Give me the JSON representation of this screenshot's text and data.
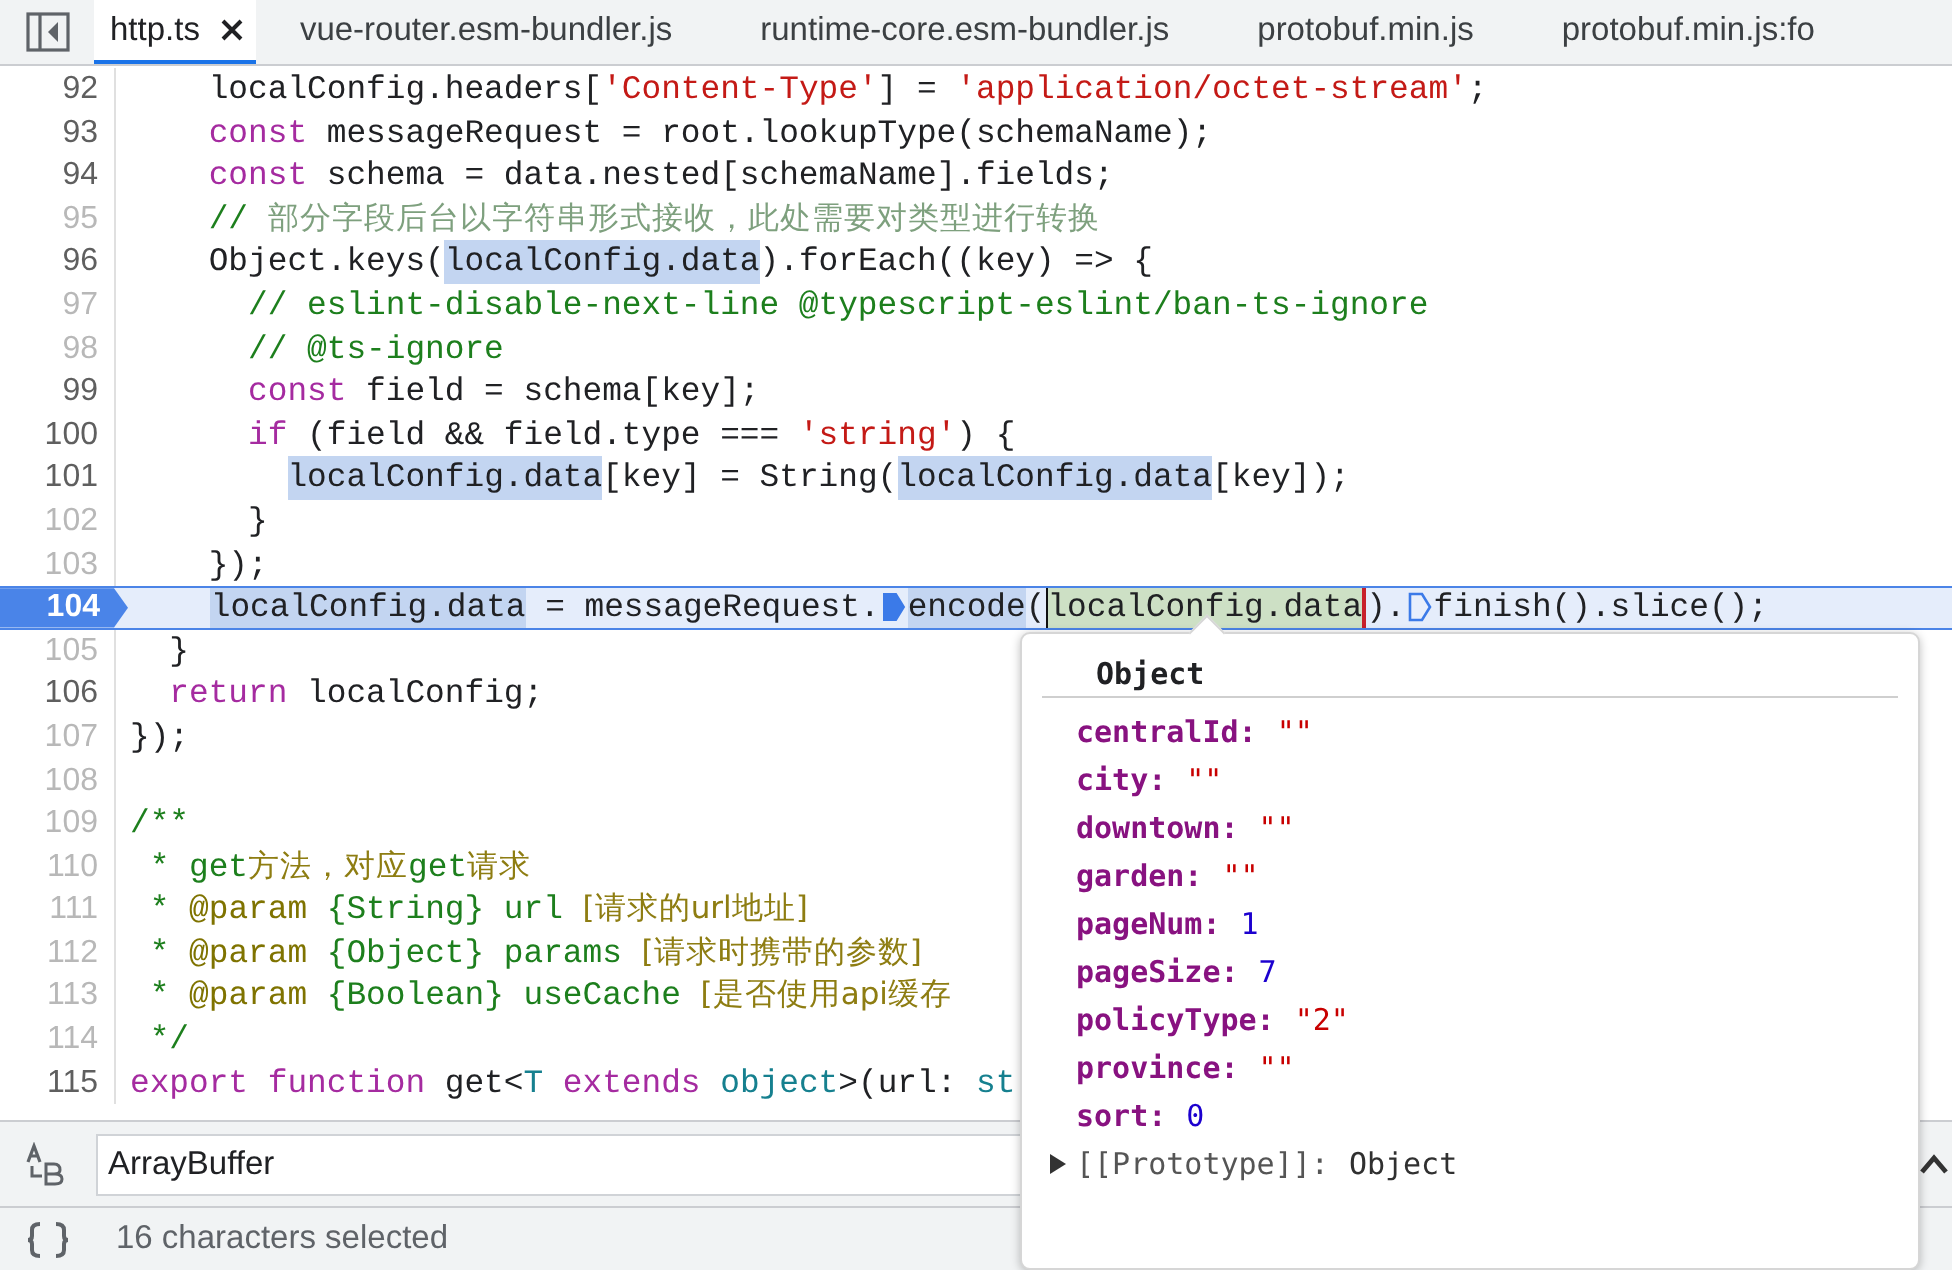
{
  "tabs": [
    {
      "label": "http.ts",
      "selected": true,
      "closable": true
    },
    {
      "label": "vue-router.esm-bundler.js",
      "selected": false,
      "closable": false
    },
    {
      "label": "runtime-core.esm-bundler.js",
      "selected": false,
      "closable": false
    },
    {
      "label": "protobuf.min.js",
      "selected": false,
      "closable": false
    },
    {
      "label": "protobuf.min.js:fo",
      "selected": false,
      "closable": false
    }
  ],
  "editor": {
    "lines": [
      {
        "number": "92",
        "dim": false,
        "current": false,
        "segments": [
          {
            "text": "    localConfig.headers[",
            "kind": "plain"
          },
          {
            "text": "'Content-Type'",
            "kind": "string"
          },
          {
            "text": "] = ",
            "kind": "plain"
          },
          {
            "text": "'application/octet-stream'",
            "kind": "string"
          },
          {
            "text": ";",
            "kind": "plain"
          }
        ]
      },
      {
        "number": "93",
        "dim": false,
        "current": false,
        "segments": [
          {
            "text": "    const",
            "kind": "keyword"
          },
          {
            "text": " messageRequest = root.lookupType(schemaName);",
            "kind": "plain"
          }
        ]
      },
      {
        "number": "94",
        "dim": false,
        "current": false,
        "segments": [
          {
            "text": "    const",
            "kind": "keyword"
          },
          {
            "text": " schema = data.nested[schemaName].fields;",
            "kind": "plain"
          }
        ]
      },
      {
        "number": "95",
        "dim": true,
        "current": false,
        "segments": [
          {
            "text": "    // ",
            "kind": "comment"
          },
          {
            "text": "部分字段后台以字符串形式接收，此处需要对类型进行转换",
            "kind": "comment-cjk"
          }
        ]
      },
      {
        "number": "96",
        "dim": false,
        "current": false,
        "segments": [
          {
            "text": "    Object.keys(",
            "kind": "plain"
          },
          {
            "text": "localConfig.data",
            "kind": "plain",
            "matched": true
          },
          {
            "text": ").forEach((key) => {",
            "kind": "plain"
          }
        ]
      },
      {
        "number": "97",
        "dim": true,
        "current": false,
        "segments": [
          {
            "text": "      // eslint-disable-next-line @typescript-eslint/ban-ts-ignore",
            "kind": "comment"
          }
        ]
      },
      {
        "number": "98",
        "dim": true,
        "current": false,
        "segments": [
          {
            "text": "      // @ts-ignore",
            "kind": "comment"
          }
        ]
      },
      {
        "number": "99",
        "dim": false,
        "current": false,
        "segments": [
          {
            "text": "      const",
            "kind": "keyword"
          },
          {
            "text": " field = schema[key];",
            "kind": "plain"
          }
        ]
      },
      {
        "number": "100",
        "dim": false,
        "current": false,
        "segments": [
          {
            "text": "      if",
            "kind": "keyword"
          },
          {
            "text": " (field && field.type === ",
            "kind": "plain"
          },
          {
            "text": "'string'",
            "kind": "string"
          },
          {
            "text": ") {",
            "kind": "plain"
          }
        ]
      },
      {
        "number": "101",
        "dim": false,
        "current": false,
        "segments": [
          {
            "text": "        localConfig.data",
            "kind": "plain",
            "matched": true
          },
          {
            "text": "[key] = String(",
            "kind": "plain"
          },
          {
            "text": "localConfig.data",
            "kind": "plain",
            "matched": true
          },
          {
            "text": "[key]);",
            "kind": "plain"
          }
        ]
      },
      {
        "number": "102",
        "dim": true,
        "current": false,
        "segments": [
          {
            "text": "      }",
            "kind": "plain"
          }
        ]
      },
      {
        "number": "103",
        "dim": true,
        "current": false,
        "segments": [
          {
            "text": "    });",
            "kind": "plain"
          }
        ]
      },
      {
        "number": "104",
        "dim": false,
        "current": true,
        "segments": [
          {
            "text": "    localConfig.data",
            "kind": "plain",
            "matched": true
          },
          {
            "text": " = messageRequest.",
            "kind": "plain"
          },
          {
            "kind": "marker",
            "active": true
          },
          {
            "text": "encode",
            "kind": "plain",
            "matched": true
          },
          {
            "text": "(",
            "kind": "plain"
          },
          {
            "text": "localConfig.data",
            "kind": "plain",
            "selected": true
          },
          {
            "text": ").",
            "kind": "plain"
          },
          {
            "kind": "marker",
            "active": false
          },
          {
            "text": "finish().slice();",
            "kind": "plain"
          }
        ]
      },
      {
        "number": "105",
        "dim": true,
        "current": false,
        "segments": [
          {
            "text": "  }",
            "kind": "plain"
          }
        ]
      },
      {
        "number": "106",
        "dim": false,
        "current": false,
        "segments": [
          {
            "text": "  return",
            "kind": "keyword"
          },
          {
            "text": " localConfig;",
            "kind": "plain"
          }
        ]
      },
      {
        "number": "107",
        "dim": true,
        "current": false,
        "segments": [
          {
            "text": "});",
            "kind": "plain"
          }
        ]
      },
      {
        "number": "108",
        "dim": true,
        "current": false
      },
      {
        "number": "109",
        "dim": true,
        "current": false,
        "segments": [
          {
            "text": "/**",
            "kind": "comment"
          }
        ]
      },
      {
        "number": "110",
        "dim": true,
        "current": false,
        "segments": [
          {
            "text": " * get",
            "kind": "comment"
          },
          {
            "text": "方法，对应",
            "kind": "doc-cjk"
          },
          {
            "text": "get",
            "kind": "comment"
          },
          {
            "text": "请求",
            "kind": "doc-cjk"
          }
        ]
      },
      {
        "number": "111",
        "dim": true,
        "current": false,
        "segments": [
          {
            "text": " * ",
            "kind": "comment"
          },
          {
            "text": "@param",
            "kind": "doc-tag"
          },
          {
            "text": " {String} url ",
            "kind": "comment"
          },
          {
            "text": "[请求的url地址]",
            "kind": "doc-cjk"
          }
        ]
      },
      {
        "number": "112",
        "dim": true,
        "current": false,
        "segments": [
          {
            "text": " * ",
            "kind": "comment"
          },
          {
            "text": "@param",
            "kind": "doc-tag"
          },
          {
            "text": " {Object} params ",
            "kind": "comment"
          },
          {
            "text": "[请求时携带的参数]",
            "kind": "doc-cjk"
          }
        ]
      },
      {
        "number": "113",
        "dim": true,
        "current": false,
        "segments": [
          {
            "text": " * ",
            "kind": "comment"
          },
          {
            "text": "@param",
            "kind": "doc-tag"
          },
          {
            "text": " {Boolean} useCache ",
            "kind": "comment"
          },
          {
            "text": "[是否使用api缓存",
            "kind": "doc-cjk"
          }
        ]
      },
      {
        "number": "114",
        "dim": true,
        "current": false,
        "segments": [
          {
            "text": " */",
            "kind": "comment"
          }
        ]
      },
      {
        "number": "115",
        "dim": false,
        "current": false,
        "segments": [
          {
            "text": "export function",
            "kind": "keyword"
          },
          {
            "text": " get<",
            "kind": "plain"
          },
          {
            "text": "T",
            "kind": "type"
          },
          {
            "text": " extends ",
            "kind": "keyword"
          },
          {
            "text": "object",
            "kind": "type"
          },
          {
            "text": ">(url: ",
            "kind": "plain"
          },
          {
            "text": "st",
            "kind": "type"
          }
        ]
      }
    ]
  },
  "popup": {
    "title": "Object",
    "properties": [
      {
        "name": "centralId:",
        "value": "\"\"",
        "kind": "string"
      },
      {
        "name": "city:",
        "value": "\"\"",
        "kind": "string"
      },
      {
        "name": "downtown:",
        "value": "\"\"",
        "kind": "string"
      },
      {
        "name": "garden:",
        "value": "\"\"",
        "kind": "string"
      },
      {
        "name": "pageNum:",
        "value": "1",
        "kind": "number"
      },
      {
        "name": "pageSize:",
        "value": "7",
        "kind": "number"
      },
      {
        "name": "policyType:",
        "value": "\"2\"",
        "kind": "string"
      },
      {
        "name": "province:",
        "value": "\"\"",
        "kind": "string"
      },
      {
        "name": "sort:",
        "value": "0",
        "kind": "number"
      }
    ],
    "prototype": {
      "name": "[[Prototype]]:",
      "value": "Object",
      "expanded": false
    }
  },
  "find_bar": {
    "value": "ArrayBuffer"
  },
  "status_bar": {
    "text": "16 characters selected"
  }
}
